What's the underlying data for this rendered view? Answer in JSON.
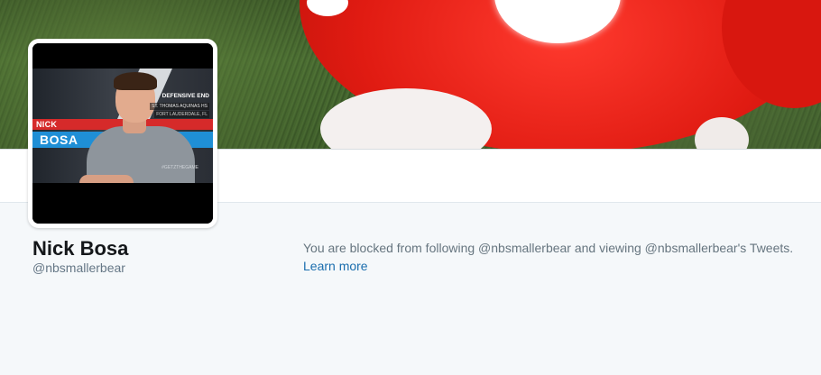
{
  "avatar": {
    "first_name": "NICK",
    "last_name": "BOSA",
    "position": "DEFENSIVE END",
    "school": "ST. THOMAS AQUINAS HS",
    "city": "FORT LAUDERDALE, FL",
    "hashtag": "#GETZTHEGAME"
  },
  "profile": {
    "name": "Nick Bosa",
    "handle": "@nbsmallerbear"
  },
  "blocked_notice": {
    "message": "You are blocked from following @nbsmallerbear and viewing @nbsmallerbear's Tweets.",
    "learn_more_label": "Learn more"
  },
  "colors": {
    "background": "#f5f8fa",
    "name_text": "#14171a",
    "secondary_text": "#657786",
    "link": "#1b6eae"
  }
}
